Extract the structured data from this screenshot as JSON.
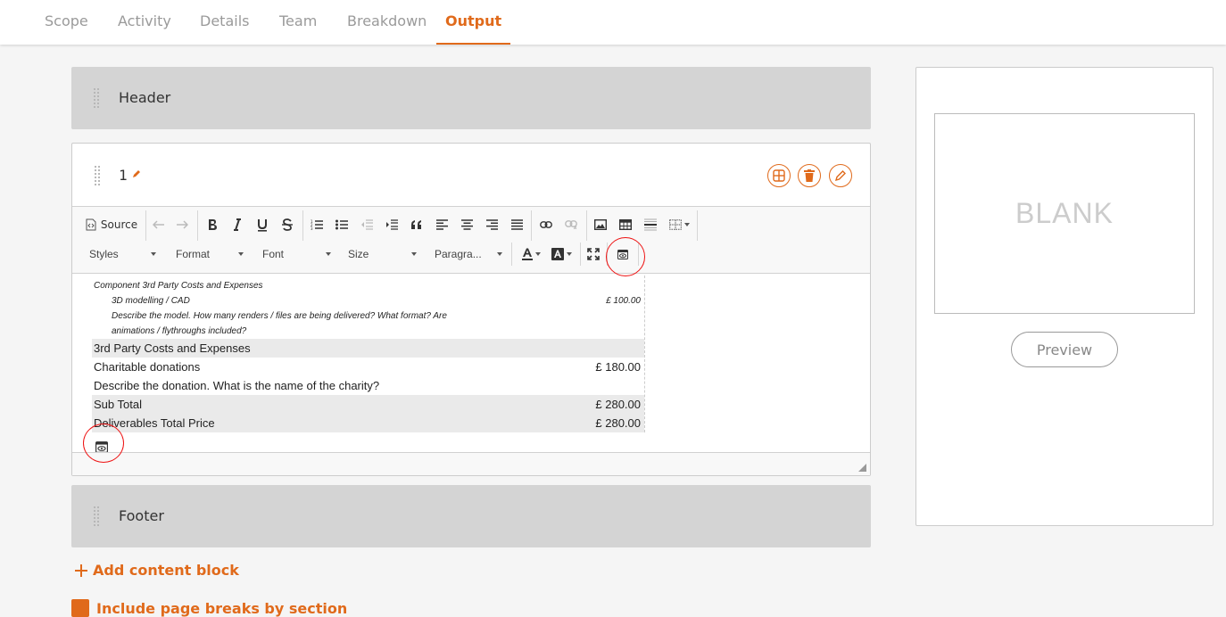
{
  "nav": {
    "tabs": [
      "Scope",
      "Activity",
      "Details",
      "Team",
      "Breakdown",
      "Output"
    ],
    "active": "Output"
  },
  "blocks": {
    "header_title": "Header",
    "footer_title": "Footer"
  },
  "editor_card": {
    "title": "1",
    "toolbar": {
      "source_label": "Source",
      "styles_label": "Styles",
      "format_label": "Format",
      "font_label": "Font",
      "size_label": "Size",
      "paragraph_label": "Paragra..."
    },
    "content": {
      "component_heading": "Component 3rd Party Costs and Expenses",
      "modelling_label": "3D modelling / CAD",
      "modelling_amount": "£ 100.00",
      "modelling_desc_1": "Describe the model. How many renders / files are being delivered? What format? Are",
      "modelling_desc_2": "animations / flythroughs included?",
      "third_party_label": "3rd Party Costs and Expenses",
      "charitable_label": "Charitable donations",
      "charitable_amount": "£ 180.00",
      "donation_desc": "Describe the donation. What is the name of the charity?",
      "subtotal_label": "Sub Total",
      "subtotal_amount": "£ 280.00",
      "deliverables_label": "Deliverables Total Price",
      "deliverables_amount": "£ 280.00"
    }
  },
  "preview": {
    "blank_label": "BLANK",
    "button_label": "Preview"
  },
  "actions": {
    "add_content_block": "Add content block",
    "include_page_breaks": "Include page breaks by section"
  },
  "colors": {
    "accent": "#e06a1b",
    "highlight_circle": "#e11111"
  }
}
